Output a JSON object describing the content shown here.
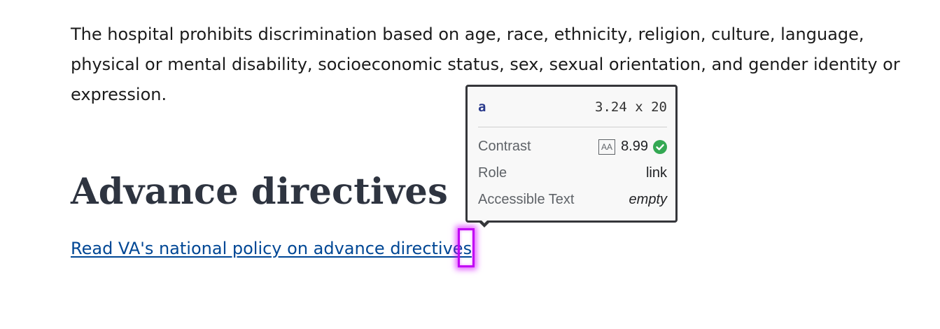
{
  "content": {
    "paragraph": "The hospital prohibits discrimination based on age, race, ethnicity, religion, culture, language, physical or mental disability, socioeconomic status, sex, sexual orientation, and gender identity or expression.",
    "heading": "Advance directives",
    "policy_link": "Read VA's national policy on advance directives"
  },
  "inspector_tooltip": {
    "element_tag": "a",
    "dimensions": "3.24 x 20",
    "rows": {
      "contrast": {
        "label": "Contrast",
        "badge": "AA",
        "value": "8.99",
        "status_icon": "check-circle-icon",
        "status_color": "#34a853"
      },
      "role": {
        "label": "Role",
        "value": "link"
      },
      "accessible_text": {
        "label": "Accessible Text",
        "value": "empty"
      }
    }
  },
  "colors": {
    "link": "#004795",
    "heading": "#2e3440",
    "highlight": "#c100f5"
  }
}
